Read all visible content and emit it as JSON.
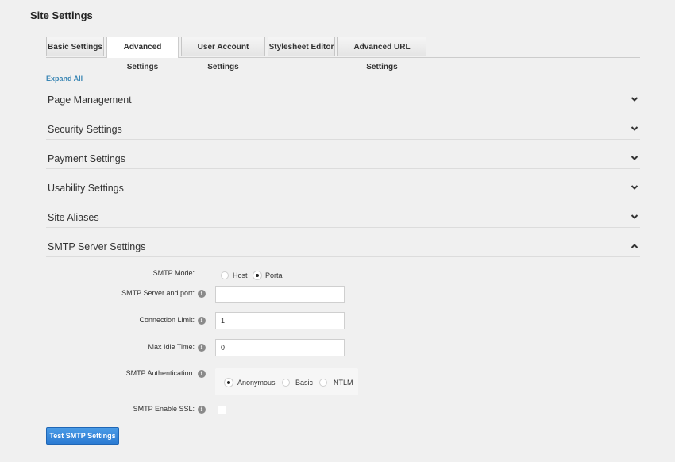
{
  "page": {
    "title": "Site Settings"
  },
  "tabs": [
    {
      "label": "Basic Settings"
    },
    {
      "label": "Advanced Settings"
    },
    {
      "label": "User Account Settings"
    },
    {
      "label": "Stylesheet Editor"
    },
    {
      "label": "Advanced URL Settings"
    }
  ],
  "expand_all": "Expand All",
  "sections": [
    {
      "label": "Page Management"
    },
    {
      "label": "Security Settings"
    },
    {
      "label": "Payment Settings"
    },
    {
      "label": "Usability Settings"
    },
    {
      "label": "Site Aliases"
    },
    {
      "label": "SMTP Server Settings"
    }
  ],
  "smtp": {
    "mode_label": "SMTP Mode:",
    "mode_options": [
      {
        "label": "Host",
        "selected": false
      },
      {
        "label": "Portal",
        "selected": true
      }
    ],
    "server_label": "SMTP Server and port:",
    "server_value": "",
    "conn_limit_label": "Connection Limit:",
    "conn_limit_value": "1",
    "idle_label": "Max Idle Time:",
    "idle_value": "0",
    "auth_label": "SMTP Authentication:",
    "auth_options": [
      {
        "label": "Anonymous",
        "selected": true
      },
      {
        "label": "Basic",
        "selected": false
      },
      {
        "label": "NTLM",
        "selected": false
      }
    ],
    "ssl_label": "SMTP Enable SSL:",
    "ssl_checked": false,
    "test_button": "Test SMTP Settings"
  },
  "icons": {
    "info": "i"
  },
  "colors": {
    "link": "#3a86b4",
    "button": "#2b7bd3"
  }
}
